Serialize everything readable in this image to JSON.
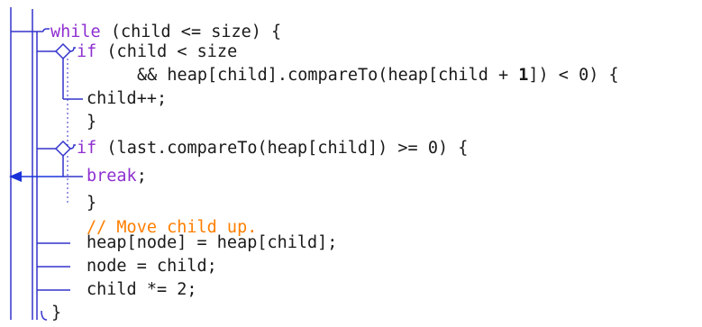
{
  "colors": {
    "structure_line": "#3333cc",
    "jump_arrow": "#1a33d9",
    "keyword": "#8e2fd0",
    "comment": "#ff7f00",
    "code_text": "#1a1a1a"
  },
  "code": {
    "while_keyword": "while",
    "while_rest": " (child <= size) {",
    "if1_keyword": "if",
    "if1_rest": " (child < size",
    "cond_continuation_start": "&& heap[child].compareTo(heap[child + ",
    "cond_number": "1",
    "cond_continuation_end": "]) < 0) {",
    "increment": "child++;",
    "if1_close": "}",
    "if2_keyword": "if",
    "if2_rest": " (last.compareTo(heap[child]) >= 0) {",
    "break_keyword": "break",
    "break_semicolon": ";",
    "if2_close": "}",
    "comment": "// Move child up.",
    "assign_heap": "heap[node] = heap[child];",
    "assign_node": "node = child;",
    "multiply_child": "child *= 2;",
    "while_close": "}"
  },
  "icons": {
    "loop": "loop-bracket-icon",
    "decision": "decision-diamond-icon",
    "exit": "exit-arrow-icon"
  }
}
